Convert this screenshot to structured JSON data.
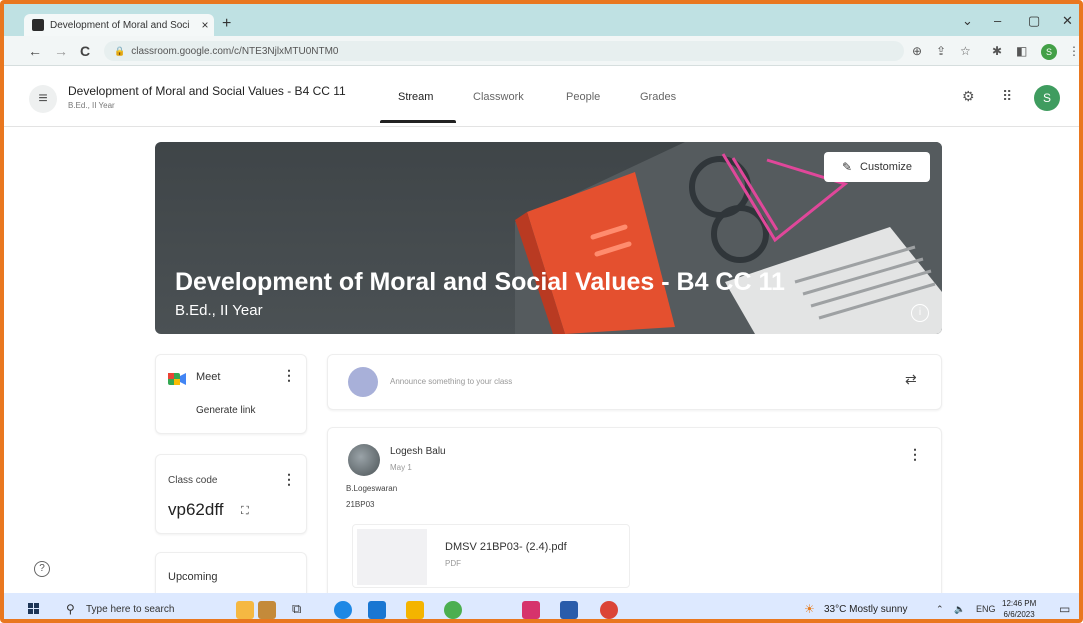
{
  "browser": {
    "tab_title": "Development of Moral and Soci",
    "new_tab": "+",
    "tab_close": "×",
    "url": "classroom.google.com/c/NTE3NjlxMTU0NTM0",
    "nav_back": "←",
    "nav_forward": "→",
    "reload": "C",
    "profile_initial": "S",
    "win_minimize": "–",
    "win_restore": "▢",
    "win_close": "✕",
    "win_chevron": "⌄"
  },
  "header": {
    "course_title": "Development of Moral and Social Values - B4 CC 11",
    "course_subtitle": "B.Ed., II Year",
    "tabs": [
      {
        "label": "Stream"
      },
      {
        "label": "Classwork"
      },
      {
        "label": "People"
      },
      {
        "label": "Grades"
      }
    ],
    "avatar_initial": "S"
  },
  "banner": {
    "title": "Development of Moral and Social Values - B4 CC 11",
    "subtitle": "B.Ed., II Year",
    "customize_label": "Customize",
    "info": "i"
  },
  "meet": {
    "label": "Meet",
    "generate_link": "Generate link"
  },
  "class_code": {
    "label": "Class code",
    "value": "vp62dff"
  },
  "upcoming": {
    "label": "Upcoming"
  },
  "announce": {
    "placeholder": "Announce something to your class"
  },
  "post": {
    "author": "Logesh Balu",
    "date": "May 1",
    "line1": "B.Logeswaran",
    "line2": "21BP03",
    "attachment_name": "DMSV 21BP03- (2.4).pdf",
    "attachment_type": "PDF"
  },
  "help": "?",
  "taskbar": {
    "search_placeholder": "Type here to search",
    "weather": "33°C  Mostly sunny",
    "language": "ENG",
    "time": "12:46 PM",
    "date": "6/6/2023"
  },
  "colors": {
    "accent_green": "#3f9c5f",
    "frame_orange": "#e9771f",
    "banner_dark": "#444a4d",
    "book_red": "#e4502f"
  }
}
